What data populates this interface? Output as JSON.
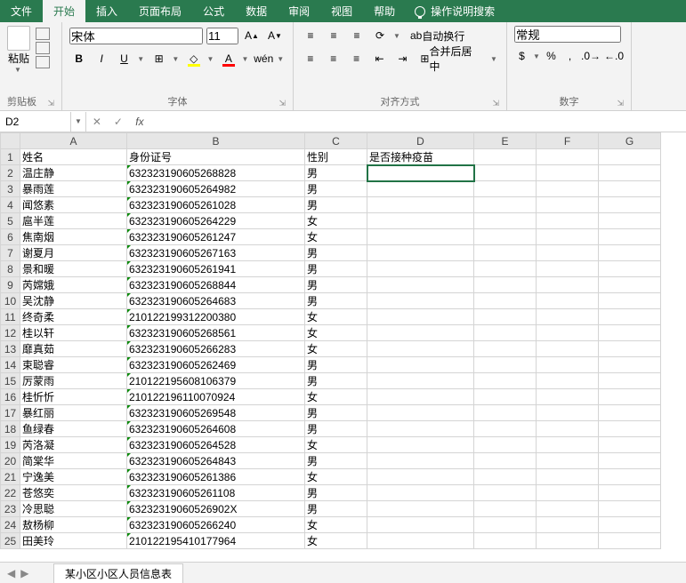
{
  "menu": {
    "tabs": [
      "文件",
      "开始",
      "插入",
      "页面布局",
      "公式",
      "数据",
      "审阅",
      "视图",
      "帮助"
    ],
    "active_index": 1,
    "tell_me": "操作说明搜索"
  },
  "ribbon": {
    "clipboard": {
      "label": "剪贴板",
      "paste": "粘贴"
    },
    "font": {
      "label": "字体",
      "name": "宋体",
      "size": "11",
      "bold": "B",
      "italic": "I",
      "underline": "U",
      "ruby": "wén"
    },
    "alignment": {
      "label": "对齐方式",
      "wrap": "自动换行",
      "merge": "合并后居中"
    },
    "number": {
      "label": "数字",
      "format": "常规"
    }
  },
  "formula_bar": {
    "name_box": "D2",
    "value": ""
  },
  "columns": {
    "row": "",
    "A": "A",
    "B": "B",
    "C": "C",
    "D": "D",
    "E": "E",
    "F": "F",
    "G": "G"
  },
  "col_widths": {
    "row": 22,
    "A": 120,
    "B": 200,
    "C": 70,
    "D": 120,
    "E": 70,
    "F": 70,
    "G": 70
  },
  "headers": {
    "A": "姓名",
    "B": "身份证号",
    "C": "性别",
    "D": "是否接种疫苗"
  },
  "selected_cell": "D2",
  "rows": [
    {
      "n": 2,
      "A": "温庄静",
      "B": "632323190605268828",
      "C": "男"
    },
    {
      "n": 3,
      "A": "暴雨莲",
      "B": "632323190605264982",
      "C": "男"
    },
    {
      "n": 4,
      "A": "闻悠素",
      "B": "632323190605261028",
      "C": "男"
    },
    {
      "n": 5,
      "A": "扈半莲",
      "B": "632323190605264229",
      "C": "女"
    },
    {
      "n": 6,
      "A": "焦南烟",
      "B": "632323190605261247",
      "C": "女"
    },
    {
      "n": 7,
      "A": "谢夏月",
      "B": "632323190605267163",
      "C": "男"
    },
    {
      "n": 8,
      "A": "景和暖",
      "B": "632323190605261941",
      "C": "男"
    },
    {
      "n": 9,
      "A": "芮嫦娥",
      "B": "632323190605268844",
      "C": "男"
    },
    {
      "n": 10,
      "A": "吴沈静",
      "B": "632323190605264683",
      "C": "男"
    },
    {
      "n": 11,
      "A": "终奇柔",
      "B": "210122199312200380",
      "C": "女"
    },
    {
      "n": 12,
      "A": "桂以轩",
      "B": "632323190605268561",
      "C": "女"
    },
    {
      "n": 13,
      "A": "靡真茹",
      "B": "632323190605266283",
      "C": "女"
    },
    {
      "n": 14,
      "A": "束聪睿",
      "B": "632323190605262469",
      "C": "男"
    },
    {
      "n": 15,
      "A": "厉蒙雨",
      "B": "210122195608106379",
      "C": "男"
    },
    {
      "n": 16,
      "A": "桂忻忻",
      "B": "210122196110070924",
      "C": "女"
    },
    {
      "n": 17,
      "A": "暴红丽",
      "B": "632323190605269548",
      "C": "男"
    },
    {
      "n": 18,
      "A": "鱼绿春",
      "B": "632323190605264608",
      "C": "男"
    },
    {
      "n": 19,
      "A": "芮洛凝",
      "B": "632323190605264528",
      "C": "女"
    },
    {
      "n": 20,
      "A": "简棠华",
      "B": "632323190605264843",
      "C": "男"
    },
    {
      "n": 21,
      "A": "宁逸美",
      "B": "632323190605261386",
      "C": "女"
    },
    {
      "n": 22,
      "A": "苍悠奕",
      "B": "632323190605261108",
      "C": "男"
    },
    {
      "n": 23,
      "A": "冷思聪",
      "B": "63232319060526902X",
      "C": "男"
    },
    {
      "n": 24,
      "A": "敖杨柳",
      "B": "632323190605266240",
      "C": "女"
    },
    {
      "n": 25,
      "A": "田美玲",
      "B": "210122195410177964",
      "C": "女"
    }
  ],
  "sheet_tab": "某小区小区人员信息表"
}
